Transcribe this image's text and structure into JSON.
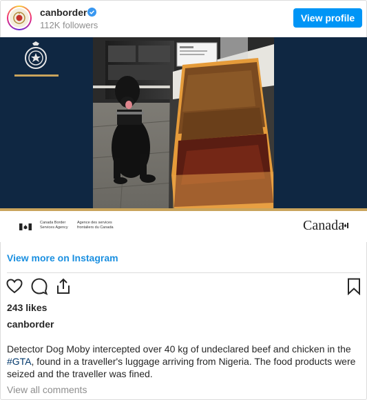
{
  "header": {
    "username": "canborder",
    "followers": "112K followers",
    "view_profile_label": "View profile"
  },
  "media": {
    "agency_en_line1": "Canada Border",
    "agency_en_line2": "Services Agency",
    "agency_fr_line1": "Agence des services",
    "agency_fr_line2": "frontaliers du Canada",
    "wordmark": "Canada"
  },
  "post": {
    "view_more_label": "View more on Instagram",
    "likes": "243 likes",
    "caption_user": "canborder",
    "caption_before": "Detector Dog Moby intercepted over 40 kg of undeclared beef and chicken in the ",
    "caption_hashtag": "#GTA",
    "caption_after": ", found in a traveller's luggage arriving from Nigeria. The food products were seized and the traveller was fined.",
    "view_comments_label": "View all comments"
  },
  "icons": [
    "heart-icon",
    "comment-icon",
    "share-icon",
    "bookmark-icon",
    "verified-badge-icon"
  ],
  "colors": {
    "accent": "#0095f6",
    "link": "#1a8fe0",
    "navy": "#0f2742",
    "gold": "#c9a45c"
  }
}
